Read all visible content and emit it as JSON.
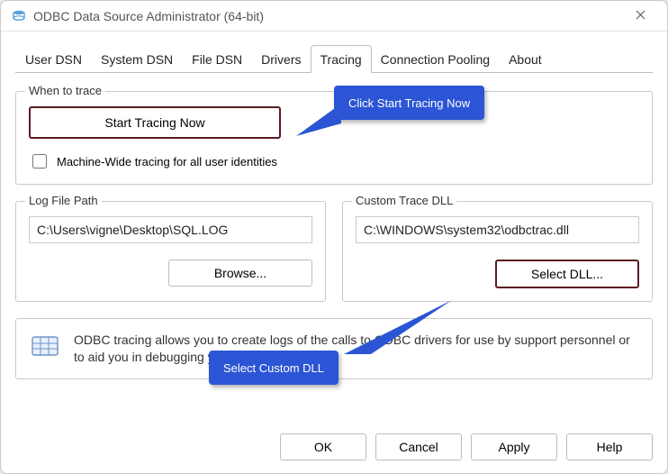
{
  "window": {
    "title": "ODBC Data Source Administrator (64-bit)"
  },
  "tabs": {
    "items": [
      "User DSN",
      "System DSN",
      "File DSN",
      "Drivers",
      "Tracing",
      "Connection Pooling",
      "About"
    ],
    "active_index": 4
  },
  "trace_group": {
    "legend": "When to trace",
    "start_button": "Start Tracing Now",
    "machine_wide_label": "Machine-Wide tracing for all user identities",
    "machine_wide_checked": false
  },
  "log_group": {
    "legend": "Log File Path",
    "path": "C:\\Users\\vigne\\Desktop\\SQL.LOG",
    "browse_label": "Browse..."
  },
  "dll_group": {
    "legend": "Custom Trace DLL",
    "path": "C:\\WINDOWS\\system32\\odbctrac.dll",
    "select_label": "Select DLL..."
  },
  "info": {
    "text": "ODBC tracing allows you to create logs of the calls to ODBC drivers for use by support personnel or to aid you in debugging your applications."
  },
  "footer": {
    "ok": "OK",
    "cancel": "Cancel",
    "apply": "Apply",
    "help": "Help"
  },
  "annotations": {
    "callout1": "Click Start Tracing Now",
    "callout2": "Select Custom DLL"
  }
}
